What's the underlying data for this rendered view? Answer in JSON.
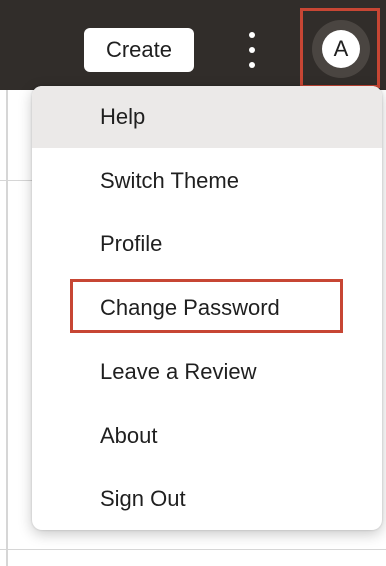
{
  "header": {
    "create_label": "Create",
    "more_icon": "kebab-vertical-icon",
    "avatar_initial": "A"
  },
  "menu": {
    "items": [
      {
        "label": "Help",
        "state": "hover"
      },
      {
        "label": "Switch Theme"
      },
      {
        "label": "Profile"
      },
      {
        "label": "Change Password",
        "highlighted": true
      },
      {
        "label": "Leave a Review"
      },
      {
        "label": "About"
      },
      {
        "label": "Sign Out"
      }
    ]
  },
  "colors": {
    "header_bg": "#312d2a",
    "highlight_border": "#c74634",
    "hover_bg": "#ebe9e8"
  }
}
